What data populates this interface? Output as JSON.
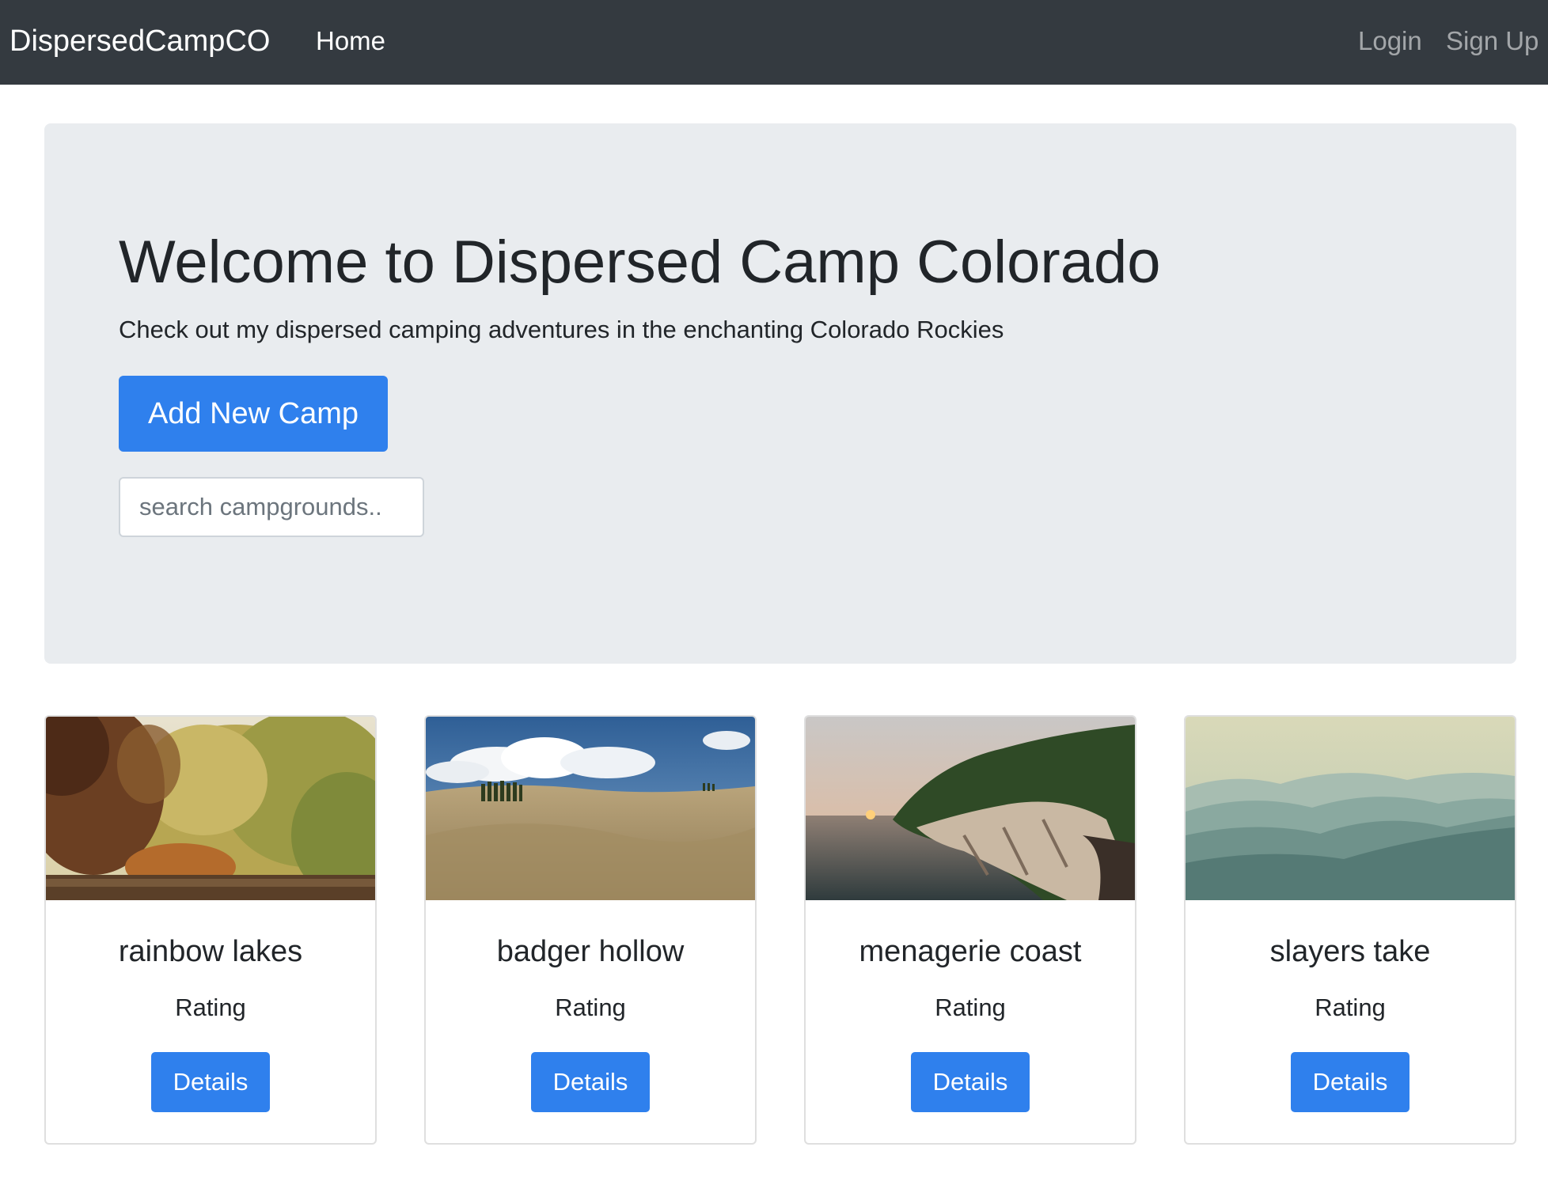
{
  "navbar": {
    "brand": "DispersedCampCO",
    "home": "Home",
    "login": "Login",
    "signup": "Sign Up"
  },
  "hero": {
    "title": "Welcome to Dispersed Camp Colorado",
    "lead": "Check out my dispersed camping adventures in the enchanting Colorado Rockies",
    "add_button": "Add New Camp",
    "search_placeholder": "search campgrounds.."
  },
  "cards": [
    {
      "title": "rainbow lakes",
      "rating": "Rating",
      "button": "Details",
      "image": "autumn-forest-river-photo"
    },
    {
      "title": "badger hollow",
      "rating": "Rating",
      "button": "Details",
      "image": "rolling-hills-cypress-photo"
    },
    {
      "title": "menagerie coast",
      "rating": "Rating",
      "button": "Details",
      "image": "coastal-cliff-sunset-photo"
    },
    {
      "title": "slayers take",
      "rating": "Rating",
      "button": "Details",
      "image": "misty-mountains-photo"
    }
  ],
  "colors": {
    "navbar_bg": "#343a40",
    "jumbotron_bg": "#e9ecef",
    "primary": "#2f80ed"
  }
}
